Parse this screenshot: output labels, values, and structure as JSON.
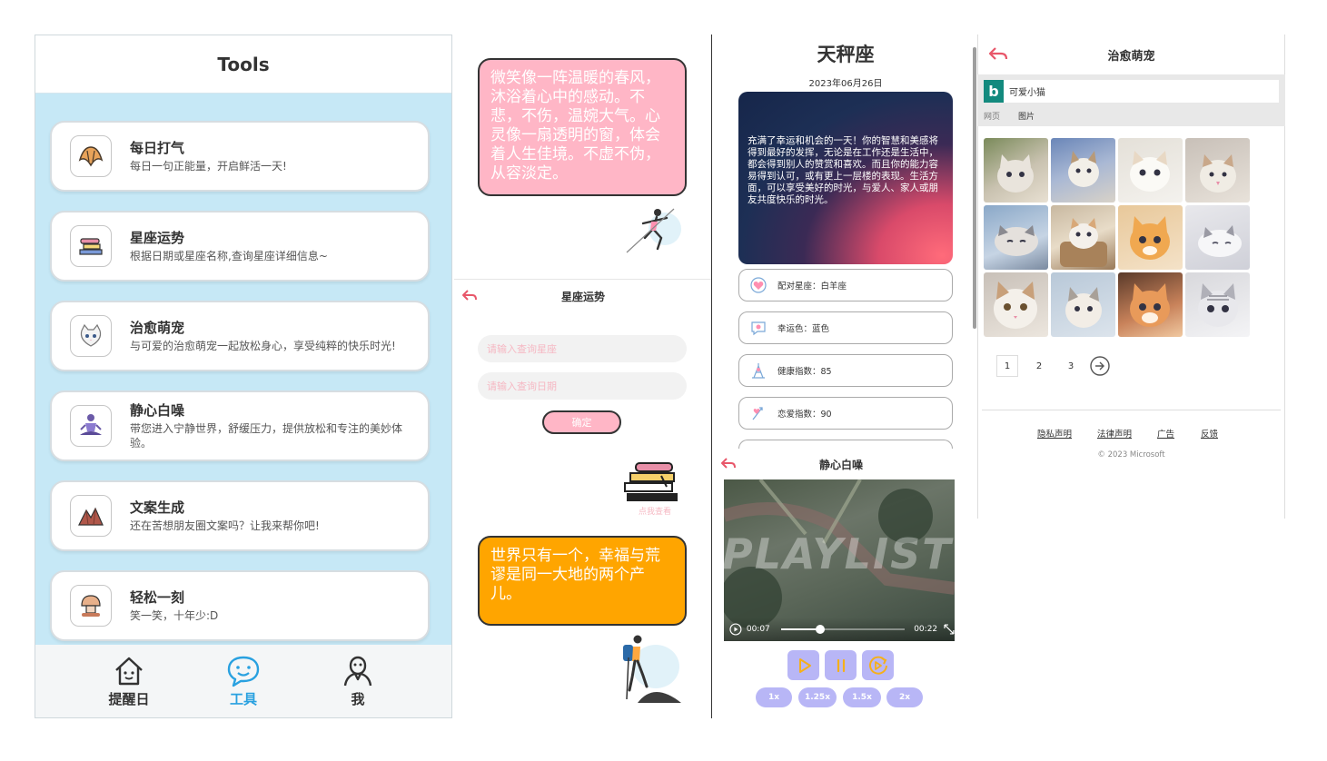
{
  "tools": {
    "title": "Tools",
    "cards": [
      {
        "title": "每日打气",
        "desc": "每日一句正能量，开启鲜活一天!"
      },
      {
        "title": "星座运势",
        "desc": "根据日期或星座名称,查询星座详细信息~"
      },
      {
        "title": "治愈萌宠",
        "desc": "与可爱的治愈萌宠一起放松身心，享受纯粹的快乐时光!"
      },
      {
        "title": "静心白噪",
        "desc": "带您进入宁静世界，舒缓压力，提供放松和专注的美妙体验。"
      },
      {
        "title": "文案生成",
        "desc": "还在苦想朋友圈文案吗？让我来帮你吧!"
      },
      {
        "title": "轻松一刻",
        "desc": "笑一笑，十年少:D"
      }
    ],
    "nav": [
      {
        "label": "提醒日",
        "active": false
      },
      {
        "label": "工具",
        "active": true
      },
      {
        "label": "我",
        "active": false
      }
    ]
  },
  "quotes": {
    "pink": "微笑像一阵温暖的春风，沐浴着心中的感动。不悲，不伤，温婉大气。心灵像一扇透明的窗，体会着人生佳境。不虚不伪，从容淡定。",
    "orange": "世界只有一个，幸福与荒谬是同一大地的两个产儿。"
  },
  "astro_search": {
    "title": "星座运势",
    "sign_placeholder": "请输入查询星座",
    "date_placeholder": "请输入查询日期",
    "confirm": "确定",
    "click_view": "点我查看"
  },
  "libra": {
    "title": "天秤座",
    "date": "2023年06月26日",
    "fortune": "充满了幸运和机会的一天！你的智慧和美感将得到最好的发挥，无论是在工作还是生活中，都会得到别人的赞赏和喜欢。而且你的能力容易得到认可，或有更上一层楼的表现。生活方面，可以享受美好的时光，与爱人、家人或朋友共度快乐的时光。",
    "rows": [
      {
        "icon": "heart-icon",
        "text": "配对星座：白羊座"
      },
      {
        "icon": "palette-icon",
        "text": "幸运色：蓝色"
      },
      {
        "icon": "health-icon",
        "text": "健康指数：85"
      },
      {
        "icon": "love-icon",
        "text": "恋爱指数：90"
      }
    ]
  },
  "noise": {
    "title": "静心白噪",
    "video_overlay": "PLAYLIST",
    "current_time": "00:07",
    "total_time": "00:22",
    "progress": 0.32,
    "speeds": [
      "1x",
      "1.25x",
      "1.5x",
      "2x"
    ]
  },
  "pets": {
    "title": "治愈萌宠",
    "query": "可爱小猫",
    "tab_web": "网页",
    "tab_images": "图片",
    "pages": [
      "1",
      "2",
      "3"
    ],
    "footer": [
      "隐私声明",
      "法律声明",
      "广告",
      "反馈"
    ],
    "copyright": "© 2023 Microsoft"
  },
  "colors": {
    "tools_bg": "#c6e8f6",
    "pink_bubble": "#ffb6c6",
    "orange_bubble": "#ffa500",
    "purple_button": "#b8b6f6",
    "nav_active": "#29a1e0",
    "bing_green": "#138a7e"
  }
}
